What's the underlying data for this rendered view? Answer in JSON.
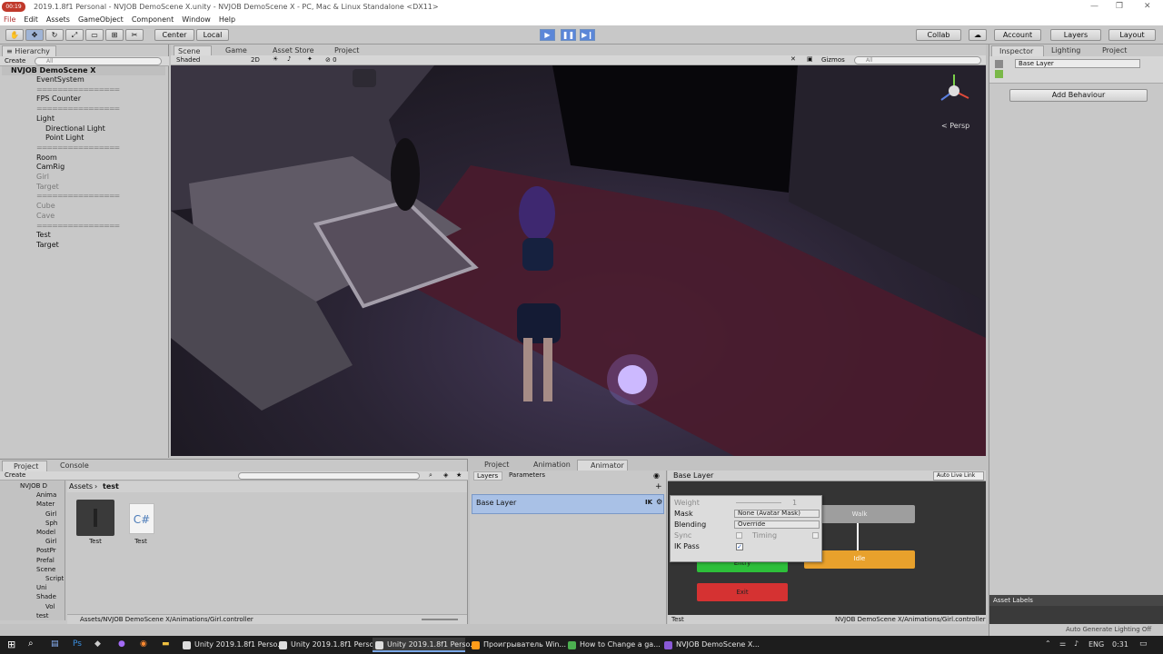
{
  "window": {
    "recording_badge": "00:19",
    "title": "2019.1.8f1 Personal - NVJOB DemoScene X.unity - NVJOB DemoScene X - PC, Mac & Linux Standalone <DX11>"
  },
  "menu": [
    "File",
    "Edit",
    "Assets",
    "GameObject",
    "Component",
    "Window",
    "Help"
  ],
  "toolbar": {
    "pivot": "Center",
    "space": "Local",
    "collab": "Collab",
    "account": "Account",
    "layers": "Layers",
    "layout": "Layout"
  },
  "hierarchy": {
    "tab": "Hierarchy",
    "create": "Create",
    "search_placeholder": "All",
    "scene": "NVJOB DemoScene X",
    "items": [
      {
        "label": "EventSystem",
        "indent": 1,
        "grey": false,
        "sep": false
      },
      {
        "label": "================",
        "indent": 1,
        "grey": true,
        "sep": true
      },
      {
        "label": "FPS Counter",
        "indent": 1,
        "grey": false,
        "sep": false
      },
      {
        "label": "================",
        "indent": 1,
        "grey": true,
        "sep": true
      },
      {
        "label": "Light",
        "indent": 1,
        "grey": false,
        "sep": false
      },
      {
        "label": "Directional Light",
        "indent": 2,
        "grey": false,
        "sep": false
      },
      {
        "label": "Point Light",
        "indent": 2,
        "grey": false,
        "sep": false
      },
      {
        "label": "================",
        "indent": 1,
        "grey": true,
        "sep": true
      },
      {
        "label": "Room",
        "indent": 1,
        "grey": false,
        "sep": false
      },
      {
        "label": "CamRig",
        "indent": 1,
        "grey": false,
        "sep": false
      },
      {
        "label": "Girl",
        "indent": 1,
        "grey": true,
        "sep": false
      },
      {
        "label": "Target",
        "indent": 1,
        "grey": true,
        "sep": false
      },
      {
        "label": "================",
        "indent": 1,
        "grey": true,
        "sep": true
      },
      {
        "label": "Cube",
        "indent": 1,
        "grey": true,
        "sep": false
      },
      {
        "label": "Cave",
        "indent": 1,
        "grey": true,
        "sep": false
      },
      {
        "label": "================",
        "indent": 1,
        "grey": true,
        "sep": true
      },
      {
        "label": "Test",
        "indent": 1,
        "grey": false,
        "sep": false
      },
      {
        "label": "Target",
        "indent": 1,
        "grey": false,
        "sep": false
      }
    ]
  },
  "scene_tabs": {
    "scene": "Scene",
    "game": "Game",
    "asset_store": "Asset Store",
    "project": "Project"
  },
  "scene_toolbar": {
    "shading": "Shaded",
    "mode_2d": "2D",
    "gizmos": "Gizmos",
    "search_placeholder": "All",
    "persp": "Persp",
    "fx_count": "0"
  },
  "inspector": {
    "tabs": [
      "Inspector",
      "Lighting",
      "Project"
    ],
    "name": "Base Layer",
    "add_behaviour": "Add Behaviour",
    "asset_labels": "Asset Labels",
    "auto_generate": "Auto Generate Lighting Off"
  },
  "project": {
    "tabs": [
      "Project",
      "Console"
    ],
    "create": "Create",
    "breadcrumb_root": "Assets",
    "breadcrumb_current": "test",
    "tree": [
      "NVJOB D",
      "Anima",
      "Mater",
      "Girl",
      "Sph",
      "Model",
      "Girl",
      "PostPr",
      "Prefal",
      "Scene",
      "Script",
      "Uni",
      "Shade",
      "Vol",
      "test"
    ],
    "assets": [
      {
        "name": "Test",
        "type": "animator"
      },
      {
        "name": "Test",
        "type": "cs",
        "glyph": "C#"
      }
    ],
    "path": "Assets/NVJOB DemoScene X/Animations/Girl.controller"
  },
  "animator": {
    "tabs": [
      "Project",
      "Animation",
      "Animator"
    ],
    "subtabs": [
      "Layers",
      "Parameters"
    ],
    "layer": "Base Layer",
    "ik_badge": "IK",
    "breadcrumb": "Base Layer",
    "auto_live": "Auto Live Link",
    "settings": {
      "weight_label": "Weight",
      "weight_value": "1",
      "mask_label": "Mask",
      "mask_value": "None (Avatar Mask)",
      "blending_label": "Blending",
      "blending_value": "Override",
      "sync_label": "Sync",
      "timing_label": "Timing",
      "ik_label": "IK Pass",
      "ik_checked": true
    },
    "states": {
      "walk": "Walk",
      "idle": "Idle",
      "entry": "Entry",
      "exit": "Exit"
    },
    "footer_left": "Test",
    "footer_right": "NVJOB DemoScene X/Animations/Girl.controller"
  },
  "taskbar": {
    "tasks": [
      {
        "label": "Unity 2019.1.8f1 Perso...",
        "color": "#dddddd",
        "active": false
      },
      {
        "label": "Unity 2019.1.8f1 Perso...",
        "color": "#dddddd",
        "active": false
      },
      {
        "label": "Unity 2019.1.8f1 Perso...",
        "color": "#dddddd",
        "active": true
      },
      {
        "label": "Проигрыватель Win...",
        "color": "#ff9c1a",
        "active": false
      },
      {
        "label": "How to Change a ga...",
        "color": "#4caf50",
        "active": false
      },
      {
        "label": "NVJOB DemoScene X...",
        "color": "#8a5ad6",
        "active": false
      }
    ],
    "lang": "ENG",
    "time": "0:31"
  }
}
